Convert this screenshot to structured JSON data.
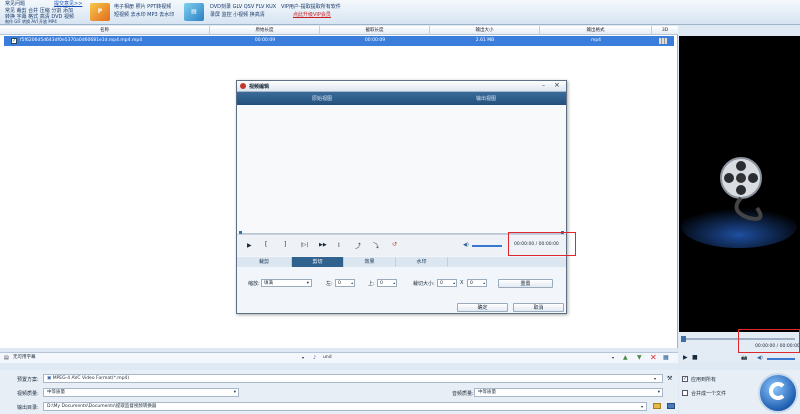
{
  "toolbar": {
    "row1": [
      "常见问题",
      "提交意见>>"
    ],
    "row2": "常见 裁剪 合并 压缩 分割 添加",
    "row3": "转换 字幕 格式 高清 DVD 视频",
    "row4": "制作 GIF 转换 AVI 开放 MP4",
    "promo1_line1": "电子相册 照片 PPT转视频",
    "promo1_line2": "短视频 去水印 MP3 去水印",
    "promo2_line1": "DVD刻录 GLV QSV FLV KUX",
    "promo2_line2": "录屏 监控 小视频 换高清",
    "vip_line1": "VIP用户-提取提取所有软件",
    "vip_line2": "点此升级VIP会员"
  },
  "list": {
    "headers": [
      "名称",
      "原始长度",
      "截取长度",
      "输出大小",
      "输出格式",
      "3D"
    ],
    "rows": [
      {
        "name": "f5f6206d5d643df0e5370a0d60681e1d.mp4.mp4.mp4",
        "orig": "00:00:09",
        "cut": "00:00:09",
        "size": "2.61 MB",
        "format": "mp4",
        "checked": true
      }
    ]
  },
  "dialog": {
    "title": "视频编辑",
    "orig_view": "原始视图",
    "out_view": "输出视图",
    "time_readout": "00:00:00 / 00:00:00",
    "tabs": [
      "裁剪",
      "剪切",
      "效果",
      "水印"
    ],
    "active_tab": 1,
    "zoom_label": "缩放:",
    "zoom_value": "填满",
    "left_label": "左:",
    "left_value": "0",
    "top_label": "上:",
    "top_value": "0",
    "cropsize_label": "裁切大小:",
    "w_value": "0",
    "x_sep": "X",
    "h_value": "0",
    "reset_label": "重置",
    "ok_label": "确定",
    "cancel_label": "取消"
  },
  "preview": {
    "time_readout": "00:00:00 / 00:00:00"
  },
  "subbar": {
    "subtitle_value": "无可用字幕",
    "audio_value": "und"
  },
  "settings": {
    "preset_label": "预置方案:",
    "preset_value": "MPEG-4 AVC Video Format(*.mp4)",
    "vquality_label": "视频质量:",
    "vquality_value": "中等质量",
    "aquality_label": "音频质量:",
    "aquality_value": "中等质量",
    "outdir_label": "输出目录:",
    "outdir_value": "D:\\My Documents\\Documents\\提取监督视频转换器",
    "apply_all": "应用到所有",
    "merge_one": "合并成一个文件"
  },
  "colors": {
    "accent": "#3b7ddb",
    "dialog_header": "#24507c",
    "highlight_red": "#e0262f"
  }
}
